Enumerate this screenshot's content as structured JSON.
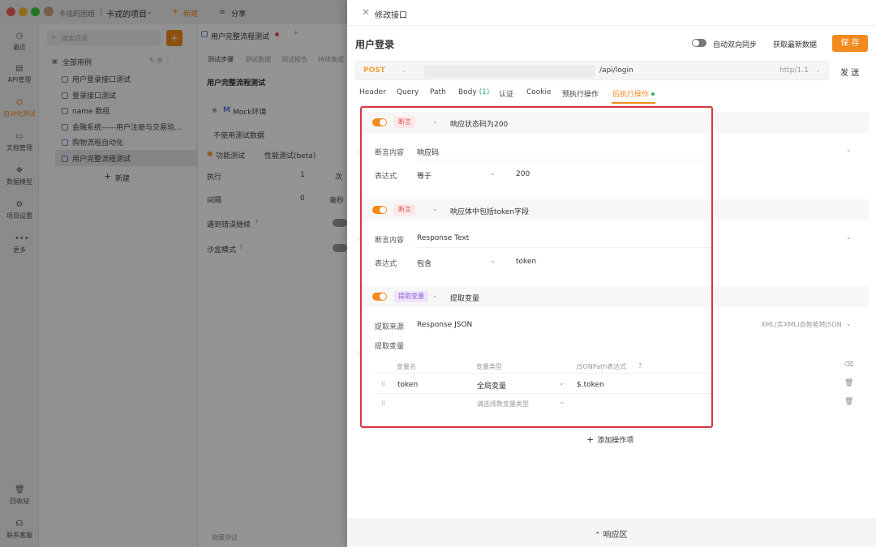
{
  "window": {
    "traffic_colors": [
      "#f25f58",
      "#fbbe2e",
      "#39c840"
    ]
  },
  "top_bar": {
    "team": "卡戎的团组",
    "project": "卡戎的项目",
    "new_label": "新建",
    "share_label": "分享"
  },
  "rail": {
    "items": [
      {
        "icon": "clock-icon",
        "label": "最近"
      },
      {
        "icon": "api-icon",
        "label": "API管理"
      },
      {
        "icon": "automation-icon",
        "label": "自动化测试"
      },
      {
        "icon": "doc-icon",
        "label": "文档管理"
      },
      {
        "icon": "model-icon",
        "label": "数据模型"
      },
      {
        "icon": "settings-icon",
        "label": "项目设置"
      },
      {
        "icon": "more-icon",
        "label": "更多"
      },
      {
        "icon": "trash-icon",
        "label": "回收站"
      },
      {
        "icon": "support-icon",
        "label": "联系客服"
      }
    ]
  },
  "tree": {
    "search_placeholder": "搜索目录",
    "root": "全部用例",
    "items": [
      "用户登录接口测试",
      "登录接口测试",
      "name 数组",
      "金融系统——用户注册与交易验...",
      "购物流程自动化",
      "用户完整流程测试"
    ],
    "new_label": "新建"
  },
  "mid_panel": {
    "tab_title": "用户完整流程测试",
    "subtabs": [
      "测试步骤",
      "测试数据",
      "测试报告",
      "持续集成"
    ],
    "case_title": "用户完整流程测试",
    "env": "Mock环境",
    "no_data": "不使用测试数据",
    "func_test": "功能测试",
    "perf_test": "性能测试(beta)",
    "exec_label": "执行",
    "exec_value": "1",
    "exec_unit": "次",
    "interval_label": "间隔",
    "interval_value": "0",
    "interval_unit": "毫秒",
    "continue_on_error": "遇到错误继续",
    "sandbox": "沙盒模式",
    "bottom_link": "隐藏测试"
  },
  "drawer": {
    "title": "修改接口",
    "api_name": "用户登录",
    "sync_label": "自动双向同步",
    "fetch_label": "获取最新数据",
    "save_label": "保 存",
    "method": "POST",
    "path": "/api/login",
    "http_version": "http/1.1",
    "send_label": "发 送",
    "tabs": [
      "Header",
      "Query",
      "Path",
      "Body",
      "认证",
      "Cookie",
      "预执行操作",
      "后执行操作"
    ],
    "body_count": "(1)",
    "active_tab": "后执行操作",
    "add_op_label": "添加操作项",
    "response_label": "响应区"
  },
  "operations": [
    {
      "type": "断言",
      "desc": "响应状态码为200",
      "enabled": true,
      "target_label": "断言内容",
      "target": "响应码",
      "expr_label": "表达式",
      "expr": "等于",
      "value": "200"
    },
    {
      "type": "断言",
      "desc": "响应体中包括token字段",
      "enabled": true,
      "target_label": "断言内容",
      "target": "Response Text",
      "expr_label": "表达式",
      "expr": "包含",
      "value": "token"
    }
  ],
  "extract": {
    "type": "提取变量",
    "desc": "提取变量",
    "enabled": true,
    "source_label": "提取来源",
    "source": "Response JSON",
    "source_hint": "XML(实XML)自智能转JSON",
    "vars_label": "提取变量",
    "columns": [
      "变量名",
      "变量类型",
      "JSONPath表达式"
    ],
    "rows": [
      {
        "name": "token",
        "type": "全局变量",
        "path": "$.token"
      },
      {
        "name": "",
        "type": "请选择数变量类型",
        "path": ""
      }
    ]
  },
  "colors": {
    "accent": "#f28a1e",
    "highlight_border": "#d9363e",
    "success": "#2ab27b"
  }
}
